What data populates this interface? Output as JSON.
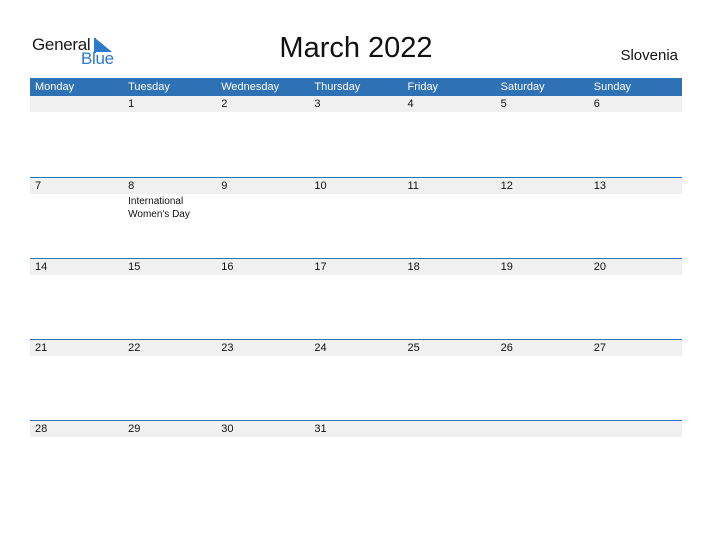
{
  "logo": {
    "general": "General",
    "blue": "Blue"
  },
  "title": "March 2022",
  "country": "Slovenia",
  "colors": {
    "accent": "#2e72b5",
    "logo_blue": "#2b7bc8",
    "date_strip": "#f0f0f0"
  },
  "weekdays": [
    "Monday",
    "Tuesday",
    "Wednesday",
    "Thursday",
    "Friday",
    "Saturday",
    "Sunday"
  ],
  "weeks": [
    {
      "dates": [
        "",
        "1",
        "2",
        "3",
        "4",
        "5",
        "6"
      ],
      "events": [
        "",
        "",
        "",
        "",
        "",
        "",
        ""
      ]
    },
    {
      "dates": [
        "7",
        "8",
        "9",
        "10",
        "11",
        "12",
        "13"
      ],
      "events": [
        "",
        "International Women's Day",
        "",
        "",
        "",
        "",
        ""
      ]
    },
    {
      "dates": [
        "14",
        "15",
        "16",
        "17",
        "18",
        "19",
        "20"
      ],
      "events": [
        "",
        "",
        "",
        "",
        "",
        "",
        ""
      ]
    },
    {
      "dates": [
        "21",
        "22",
        "23",
        "24",
        "25",
        "26",
        "27"
      ],
      "events": [
        "",
        "",
        "",
        "",
        "",
        "",
        ""
      ]
    },
    {
      "dates": [
        "28",
        "29",
        "30",
        "31",
        "",
        "",
        ""
      ],
      "events": [
        "",
        "",
        "",
        "",
        "",
        "",
        ""
      ]
    }
  ]
}
